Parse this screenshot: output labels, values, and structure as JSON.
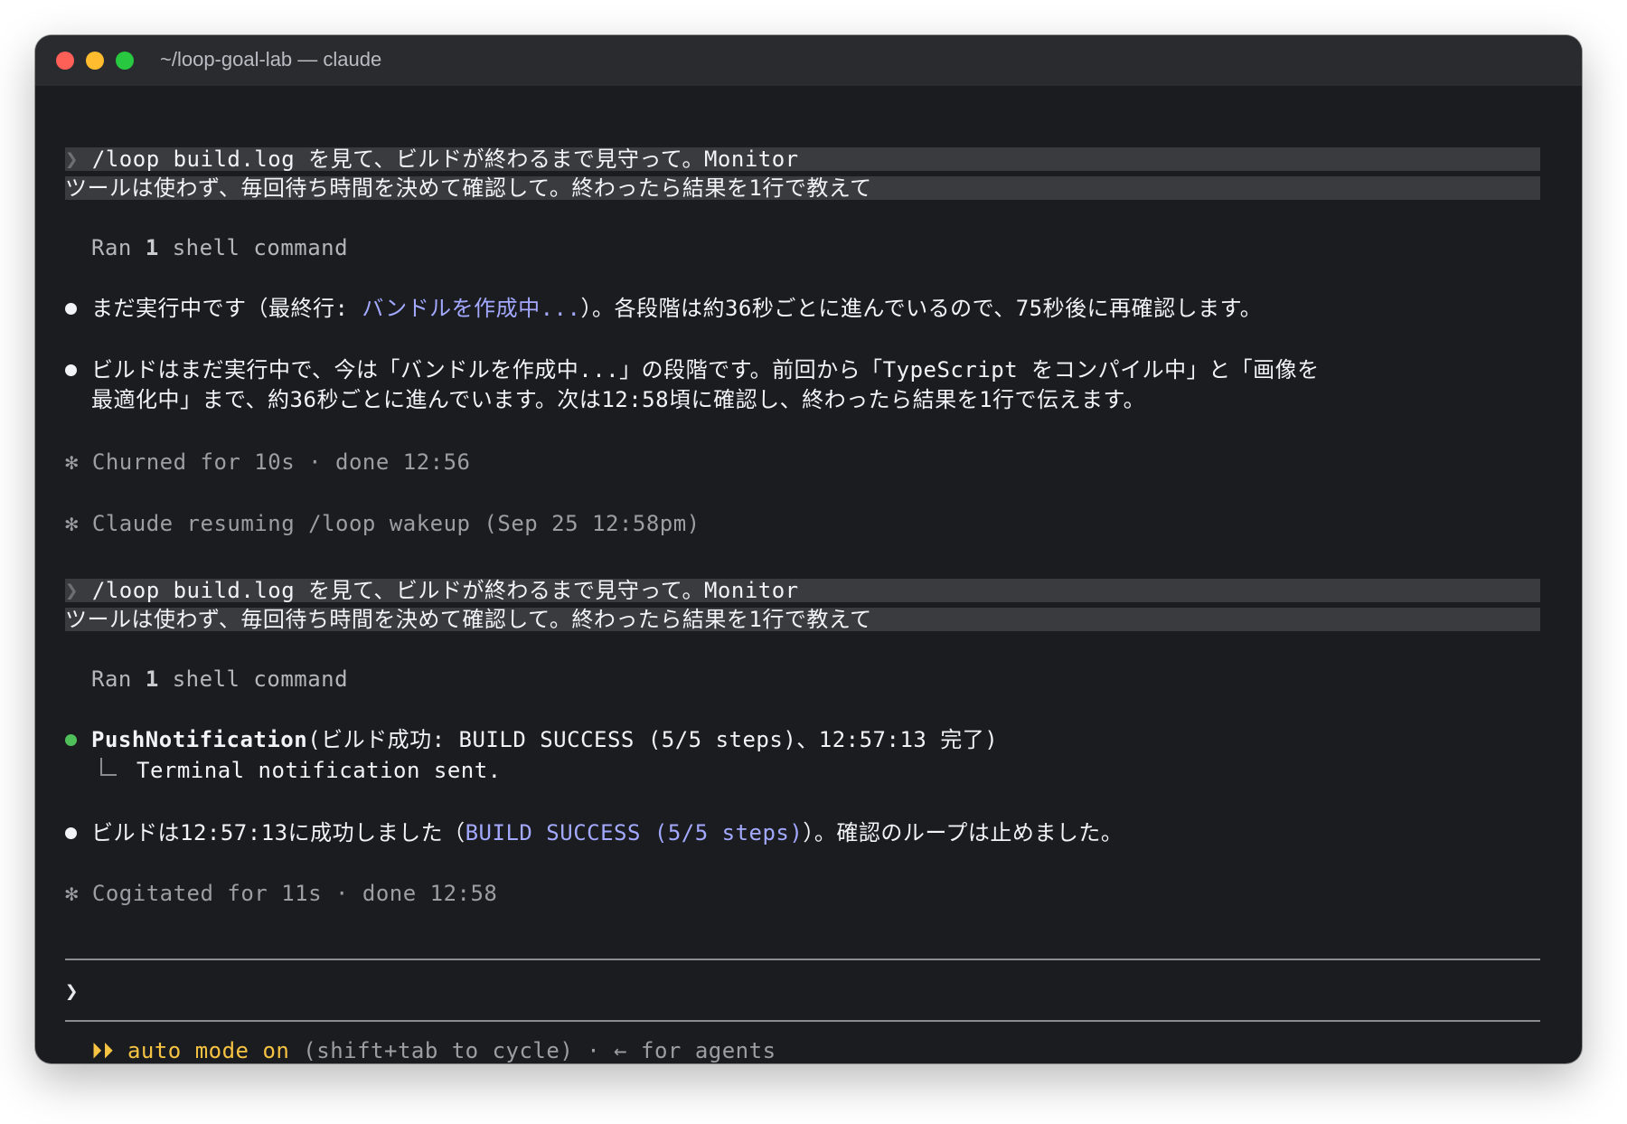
{
  "window": {
    "title": "~/loop-goal-lab — claude"
  },
  "transcript": {
    "prompt1": {
      "chevron": "❯",
      "line1": "/loop build.log を見て、ビルドが終わるまで見守って。Monitor",
      "line2": "ツールは使わず、毎回待ち時間を決めて確認して。終わったら結果を1行で教えて"
    },
    "tool1": {
      "prefix": "Ran",
      "count": "1",
      "suffix": "shell command"
    },
    "msg1": {
      "a": "まだ実行中です（最終行: ",
      "link": "バンドルを作成中...",
      "b": "）。各段階は約36秒ごとに進んでいるので、75秒後に再確認します。"
    },
    "msg2": {
      "line1": "ビルドはまだ実行中で、今は「バンドルを作成中...」の段階です。前回から「TypeScript をコンパイル中」と「画像を",
      "line2": "最適化中」まで、約36秒ごとに進んでいます。次は12:58頃に確認し、終わったら結果を1行で伝えます。"
    },
    "status1": {
      "icon": "✻",
      "text": "Churned for 10s · done 12:56"
    },
    "status2": {
      "icon": "✻",
      "text": "Claude resuming /loop wakeup (Sep 25 12:58pm)"
    },
    "prompt2": {
      "chevron": "❯",
      "line1": "/loop build.log を見て、ビルドが終わるまで見守って。Monitor",
      "line2": "ツールは使わず、毎回待ち時間を決めて確認して。終わったら結果を1行で教えて"
    },
    "tool2": {
      "prefix": "Ran",
      "count": "1",
      "suffix": "shell command"
    },
    "push": {
      "name": "PushNotification",
      "args": "(ビルド成功: BUILD SUCCESS (5/5 steps)、12:57:13 完了)",
      "result": "Terminal notification sent.",
      "bullet_color": "#4fbf5a"
    },
    "msg3": {
      "a": "ビルドは12:57:13に成功しました（",
      "link": "BUILD SUCCESS (5/5 steps)",
      "b": "）。確認のループは止めました。"
    },
    "status3": {
      "icon": "✻",
      "text": "Cogitated for 11s · done 12:58"
    }
  },
  "input": {
    "chevron": "❯",
    "value": ""
  },
  "footer": {
    "arrows": "⏵⏵",
    "mode": "auto mode on",
    "hint": " (shift+tab to cycle) · ← for agents"
  },
  "colors": {
    "background": "#1b1c20",
    "accent_link": "#a3a9ff",
    "auto_mode": "#f6c342",
    "success_bullet": "#4fbf5a"
  }
}
